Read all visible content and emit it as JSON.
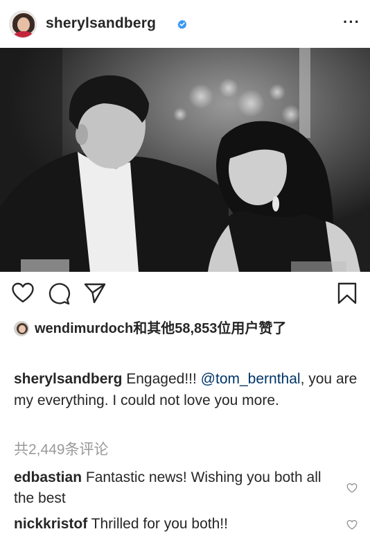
{
  "post": {
    "username": "sherylsandberg",
    "verified": true,
    "more_label": "···"
  },
  "likes": {
    "liker": "wendimurdoch",
    "text": "和其他58,853位用户赞了"
  },
  "caption": {
    "user": "sherylsandberg",
    "text_before": "Engaged!!! ",
    "mention": "@tom_bernthal",
    "text_after": ", you are my everything. I could not love you more."
  },
  "view_all_comments": "共2,449条评论",
  "comments": [
    {
      "user": "edbastian",
      "text": "Fantastic news! Wishing you both all the best"
    },
    {
      "user": "nickkristof",
      "text": "Thrilled for you both!!"
    }
  ],
  "icons": {
    "verified": "verified-badge-icon",
    "like": "heart-icon",
    "comment": "comment-icon",
    "share": "paper-plane-icon",
    "save": "bookmark-icon",
    "comment_like": "small-heart-icon"
  },
  "colors": {
    "text": "#262626",
    "verified": "#3897f0",
    "muted": "#999999",
    "mention": "#003569"
  }
}
